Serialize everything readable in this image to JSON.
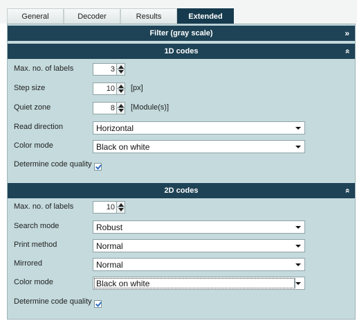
{
  "tabs": [
    {
      "label": "General",
      "active": false
    },
    {
      "label": "Decoder",
      "active": false
    },
    {
      "label": "Results",
      "active": false
    },
    {
      "label": "Extended",
      "active": true
    }
  ],
  "filter_section": {
    "title": "Filter (gray scale)",
    "expanded": false
  },
  "codes_1d": {
    "title": "1D codes",
    "expanded": true,
    "max_labels": {
      "label": "Max. no. of labels",
      "value": "3"
    },
    "step_size": {
      "label": "Step size",
      "value": "10",
      "unit": "[px]"
    },
    "quiet_zone": {
      "label": "Quiet zone",
      "value": "8",
      "unit": "[Module(s)]"
    },
    "read_direction": {
      "label": "Read direction",
      "value": "Horizontal"
    },
    "color_mode": {
      "label": "Color mode",
      "value": "Black on white"
    },
    "determine_quality": {
      "label": "Determine code quality",
      "checked": true
    }
  },
  "codes_2d": {
    "title": "2D codes",
    "expanded": true,
    "max_labels": {
      "label": "Max. no. of labels",
      "value": "10"
    },
    "search_mode": {
      "label": "Search mode",
      "value": "Robust"
    },
    "print_method": {
      "label": "Print method",
      "value": "Normal"
    },
    "mirrored": {
      "label": "Mirrored",
      "value": "Normal"
    },
    "color_mode": {
      "label": "Color mode",
      "value": "Black on white"
    },
    "determine_quality": {
      "label": "Determine code quality",
      "checked": true
    }
  },
  "colors": {
    "header_bg": "#1e4356",
    "panel_bg": "#c4dadd",
    "active_tab": "#163b4e"
  }
}
